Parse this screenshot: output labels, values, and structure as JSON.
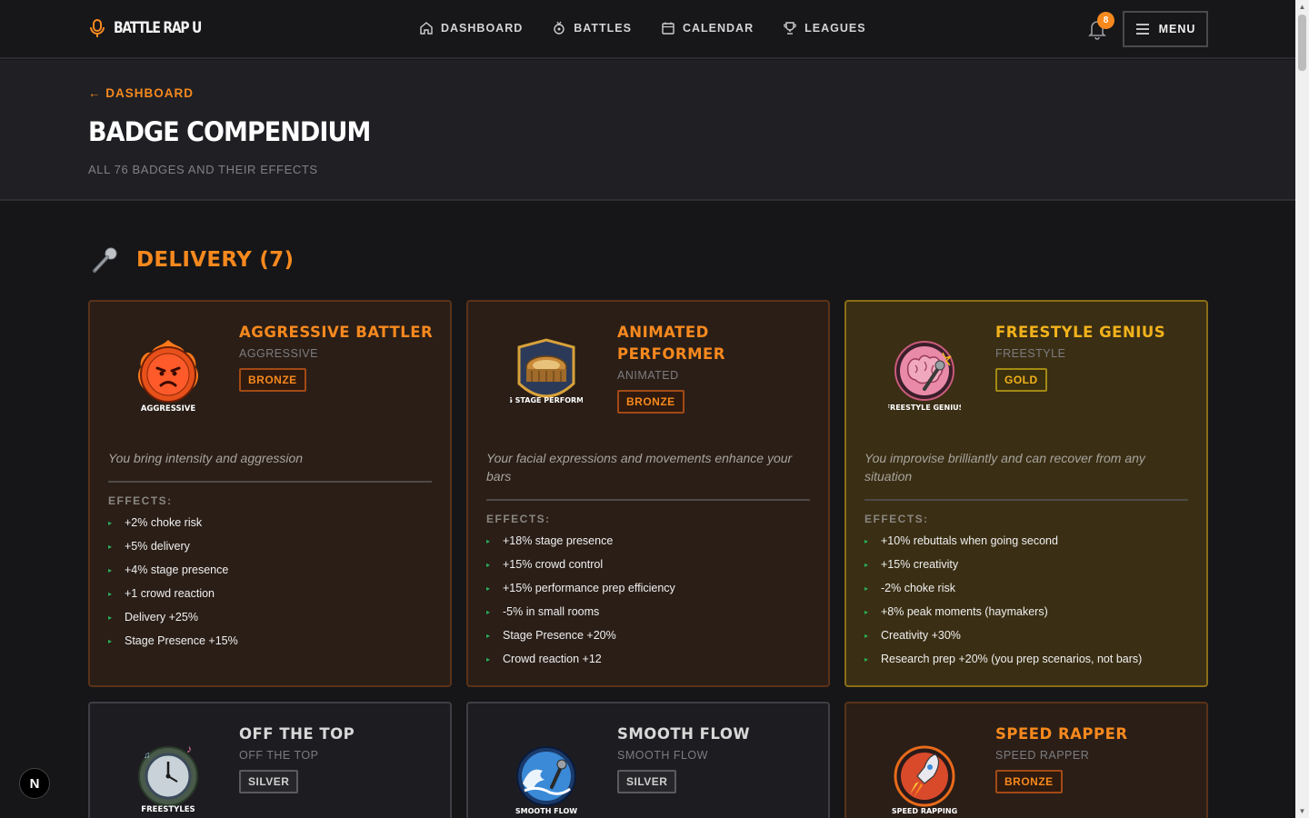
{
  "app": {
    "logo_text": "BATTLE RAP U"
  },
  "nav": {
    "links": [
      {
        "label": "DASHBOARD",
        "icon": "home-icon"
      },
      {
        "label": "BATTLES",
        "icon": "battles-icon"
      },
      {
        "label": "CALENDAR",
        "icon": "calendar-icon"
      },
      {
        "label": "LEAGUES",
        "icon": "trophy-icon"
      }
    ],
    "notification_count": "8",
    "menu_label": "MENU"
  },
  "header": {
    "back_label": "← DASHBOARD",
    "title": "BADGE COMPENDIUM",
    "subtitle": "ALL 76 BADGES AND THEIR EFFECTS"
  },
  "section": {
    "title": "DELIVERY (7)",
    "icon": "microphone-icon"
  },
  "effects_label": "EFFECTS:",
  "cards": [
    {
      "name": "AGGRESSIVE BATTLER",
      "slug": "AGGRESSIVE",
      "tier": "BRONZE",
      "image_caption": "AGGRESSIVE",
      "description": "You bring intensity and aggression",
      "effects": [
        "+2% choke risk",
        "+5% delivery",
        "+4% stage presence",
        "+1 crowd reaction",
        "Delivery +25%",
        "Stage Presence +15%"
      ]
    },
    {
      "name": "ANIMATED PERFORMER",
      "slug": "ANIMATED",
      "tier": "BRONZE",
      "image_caption": "BIG STAGE PERFORMER",
      "description": "Your facial expressions and movements enhance your bars",
      "effects": [
        "+18% stage presence",
        "+15% crowd control",
        "+15% performance prep efficiency",
        "-5% in small rooms",
        "Stage Presence +20%",
        "Crowd reaction +12"
      ]
    },
    {
      "name": "FREESTYLE GENIUS",
      "slug": "FREESTYLE",
      "tier": "GOLD",
      "image_caption": "FREESTYLE GENIUS",
      "description": "You improvise brilliantly and can recover from any situation",
      "effects": [
        "+10% rebuttals when going second",
        "+15% creativity",
        "-2% choke risk",
        "+8% peak moments (haymakers)",
        "Creativity +30%",
        "Research prep +20% (you prep scenarios, not bars)"
      ]
    },
    {
      "name": "OFF THE TOP",
      "slug": "OFF THE TOP",
      "tier": "SILVER",
      "image_caption": "FREESTYLES"
    },
    {
      "name": "SMOOTH FLOW",
      "slug": "SMOOTH FLOW",
      "tier": "SILVER",
      "image_caption": "SMOOTH FLOW"
    },
    {
      "name": "SPEED RAPPER",
      "slug": "SPEED RAPPER",
      "tier": "BRONZE",
      "image_caption": "SPEED RAPPING"
    }
  ],
  "colors": {
    "accent": "#f7891e",
    "gold": "#f2b21c",
    "effect_bullet": "#29b35a",
    "background": "#161618"
  },
  "misc": {
    "dev_button_label": "N"
  }
}
